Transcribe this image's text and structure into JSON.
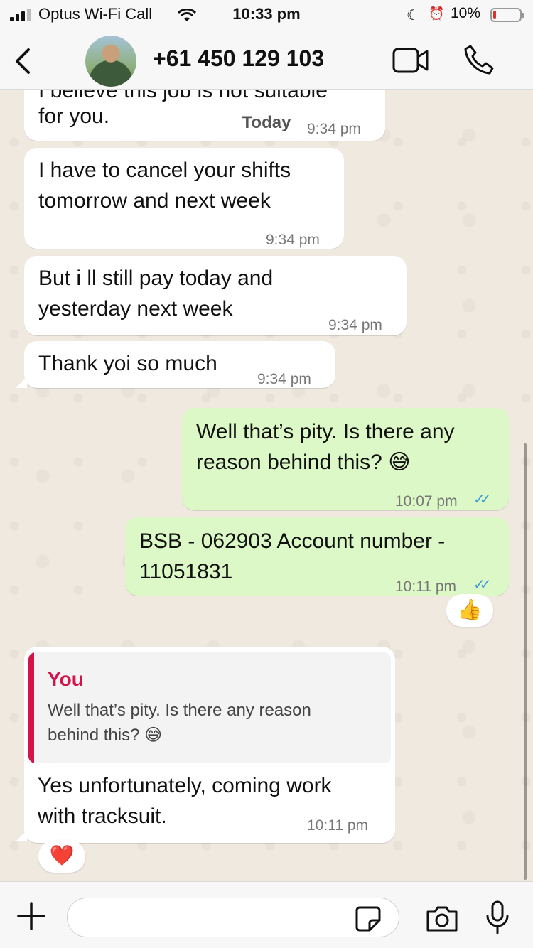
{
  "status_bar": {
    "carrier": "Optus Wi-Fi Call",
    "time": "10:33 pm",
    "battery": "10%",
    "battery_level": 0.1
  },
  "header": {
    "contact": "+61 450 129 103",
    "icons": [
      "back-icon",
      "avatar",
      "video-call-icon",
      "phone-call-icon"
    ]
  },
  "date_divider": "Today",
  "messages": [
    {
      "direction": "in",
      "text": "I believe this job is not suitable",
      "time": "",
      "partially_hidden": true
    },
    {
      "direction": "in",
      "text": "for you.",
      "time": "9:34 pm"
    },
    {
      "direction": "in",
      "line1": "I have to cancel your shifts",
      "line2": "tomorrow and next week",
      "time": "9:34 pm"
    },
    {
      "direction": "in",
      "line1": "But i ll still pay today and",
      "line2": "yesterday next week",
      "time": "9:34 pm"
    },
    {
      "direction": "in",
      "text": "Thank yoi so much",
      "time": "9:34 pm"
    },
    {
      "direction": "out",
      "line1": "Well that’s pity. Is there any",
      "line2": "reason behind this? 😅",
      "time": "10:07 pm",
      "status": "read"
    },
    {
      "direction": "out",
      "line1": "BSB - 062903 Account number -",
      "line2": "11051831",
      "time": "10:11 pm",
      "status": "read",
      "reaction": "👍"
    },
    {
      "direction": "in",
      "quote": {
        "author": "You",
        "line1": "Well that’s pity. Is there any reason",
        "line2": "behind this? 😅"
      },
      "line1": "Yes unfortunately, coming work",
      "line2": "with tracksuit.",
      "time": "10:11 pm",
      "reaction": "❤️"
    }
  ],
  "composer": {
    "placeholder": "",
    "icons": [
      "plus-icon",
      "sticker-icon",
      "camera-icon",
      "microphone-icon"
    ]
  },
  "colors": {
    "incoming_bubble": "#ffffff",
    "outgoing_bubble": "#dcf8c6",
    "quote_accent": "#d4134a",
    "read_ticks": "#3a9ad9"
  }
}
